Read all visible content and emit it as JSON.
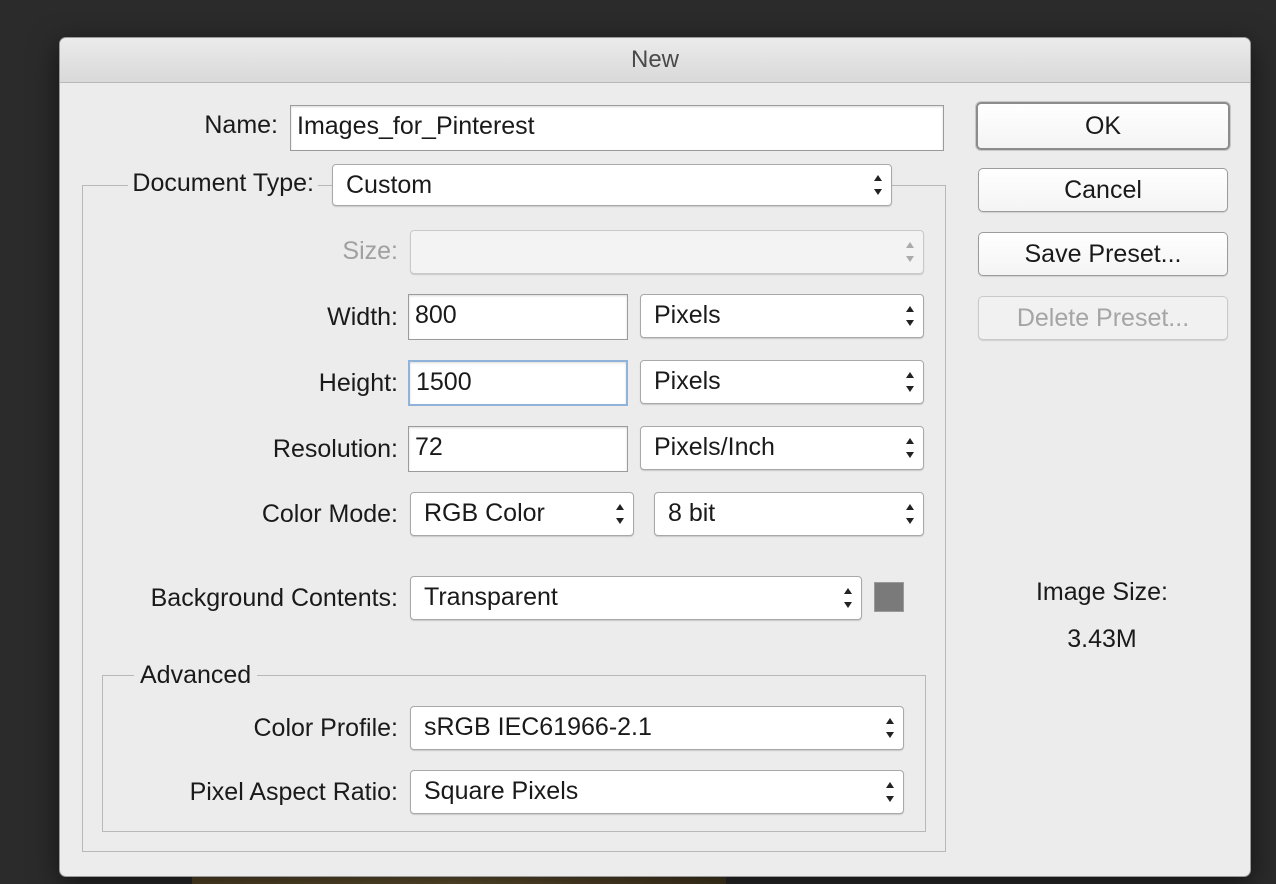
{
  "window": {
    "title": "New"
  },
  "name": {
    "label": "Name:",
    "value": "Images_for_Pinterest"
  },
  "document_type": {
    "label": "Document Type:",
    "value": "Custom"
  },
  "size": {
    "label": "Size:",
    "value": ""
  },
  "width": {
    "label": "Width:",
    "value": "800",
    "unit": "Pixels"
  },
  "height": {
    "label": "Height:",
    "value": "1500",
    "unit": "Pixels"
  },
  "resolution": {
    "label": "Resolution:",
    "value": "72",
    "unit": "Pixels/Inch"
  },
  "color_mode": {
    "label": "Color Mode:",
    "value": "RGB Color",
    "depth": "8 bit"
  },
  "background": {
    "label": "Background Contents:",
    "value": "Transparent",
    "swatch_color": "#7a7a7a"
  },
  "advanced": {
    "title": "Advanced",
    "color_profile": {
      "label": "Color Profile:",
      "value": "sRGB IEC61966-2.1"
    },
    "pixel_aspect": {
      "label": "Pixel Aspect Ratio:",
      "value": "Square Pixels"
    }
  },
  "buttons": {
    "ok": "OK",
    "cancel": "Cancel",
    "save_preset": "Save Preset...",
    "delete_preset": "Delete Preset..."
  },
  "image_size": {
    "label": "Image Size:",
    "value": "3.43M"
  }
}
